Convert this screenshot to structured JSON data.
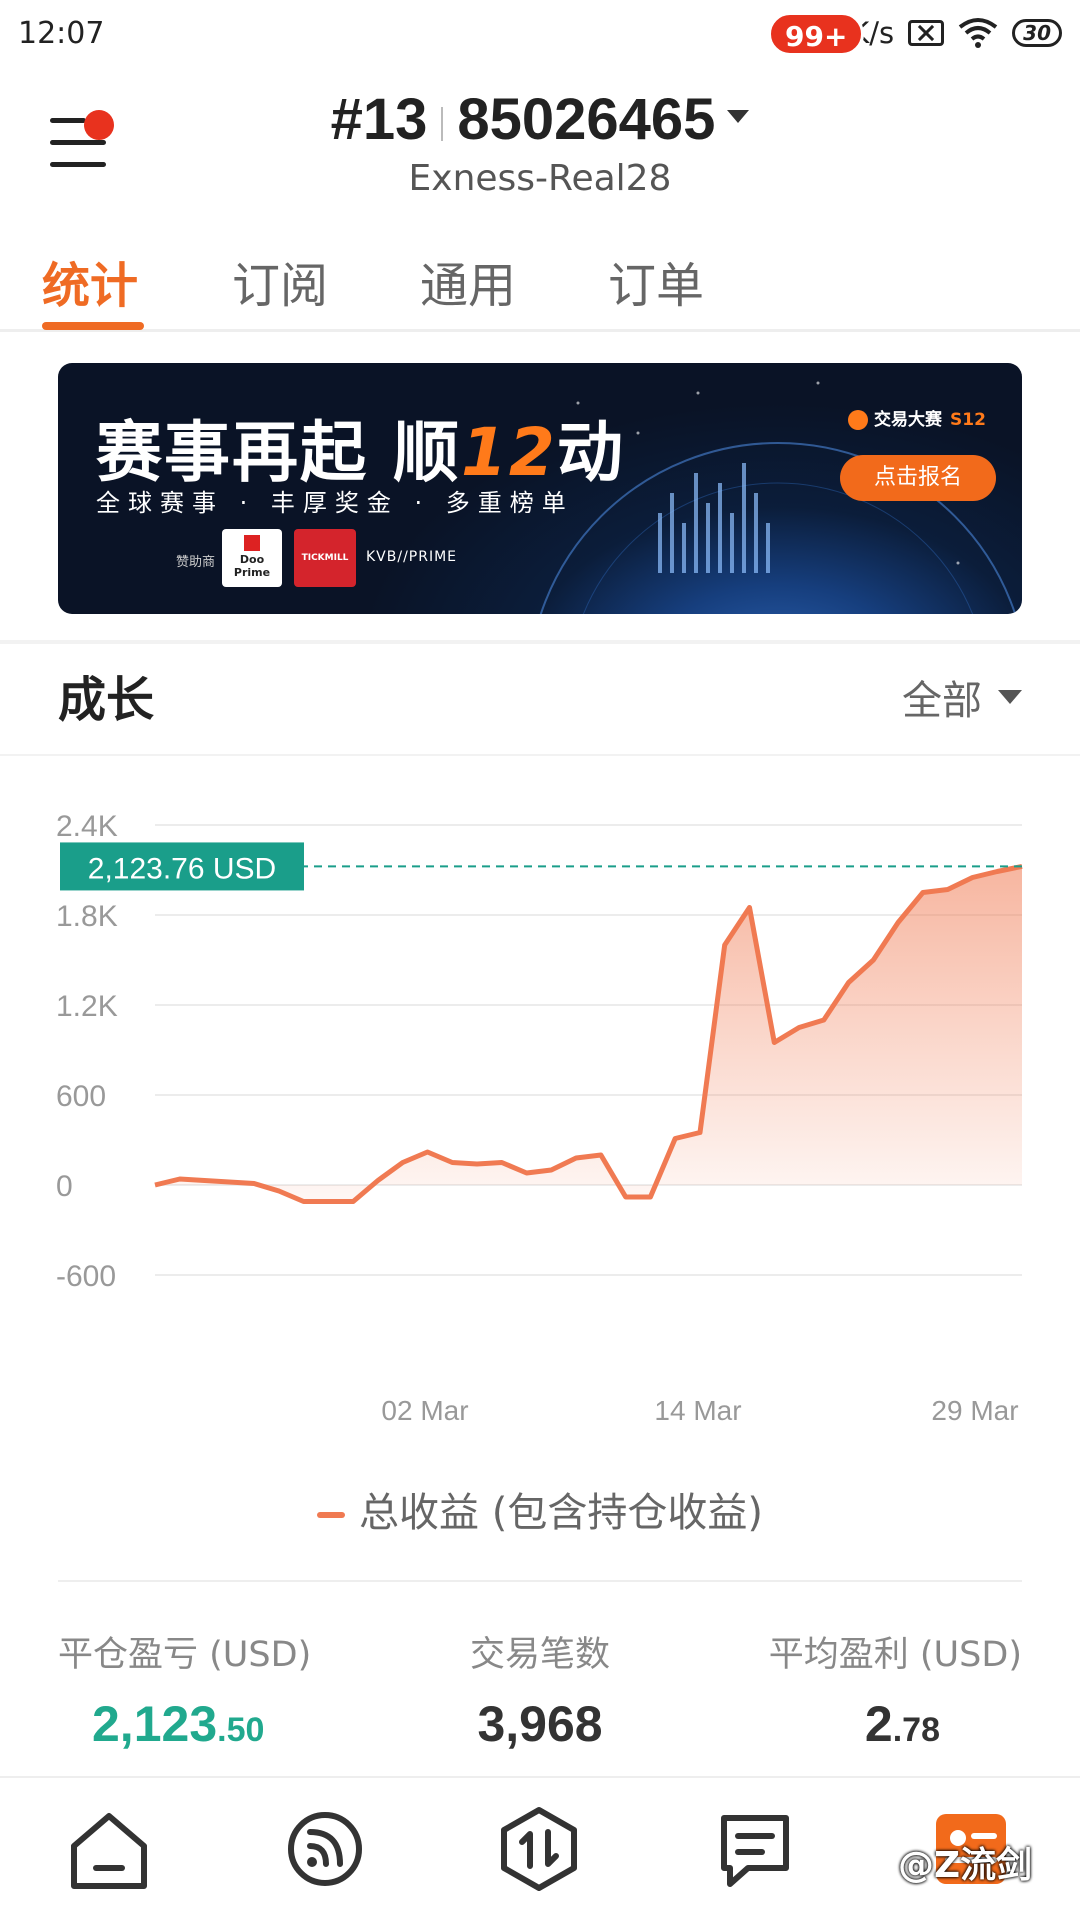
{
  "status_bar": {
    "time": "12:07",
    "net_speed": "1.5K/s",
    "battery": "30"
  },
  "header": {
    "account_prefix": "#13",
    "account_number": "85026465",
    "server": "Exness-Real28",
    "notification_dot": true
  },
  "tabs": [
    {
      "label": "统计",
      "active": true
    },
    {
      "label": "订阅",
      "active": false
    },
    {
      "label": "通用",
      "active": false
    },
    {
      "label": "订单",
      "active": false
    }
  ],
  "banner": {
    "title_a": "赛事再起 顺",
    "title_num": "12",
    "title_b": "动",
    "subtitle": "全球赛事 · 丰厚奖金 · 多重榜单",
    "sponsor_label": "赞助商",
    "sponsor_1": "Doo Prime",
    "sponsor_2": "TICKMILL",
    "sponsor_3": "KVB//PRIME",
    "brand": "交易大赛",
    "season": "S12",
    "cta": "点击报名"
  },
  "growth": {
    "title": "成长",
    "range": "全部"
  },
  "chart_data": {
    "type": "area",
    "current_value_label": "2,123.76 USD",
    "current_value": 2123.76,
    "y_ticks": [
      "2.4K",
      "1.8K",
      "1.2K",
      "600",
      "0",
      "-600"
    ],
    "ylim": [
      -600,
      2400
    ],
    "x_ticks": [
      "02 Mar",
      "14 Mar",
      "29 Mar"
    ],
    "series": [
      {
        "name": "总收益 (包含持仓收益)",
        "values": [
          0,
          40,
          30,
          20,
          10,
          -40,
          -110,
          -110,
          -110,
          30,
          150,
          220,
          150,
          140,
          150,
          80,
          100,
          180,
          200,
          -80,
          -80,
          310,
          350,
          1600,
          1850,
          950,
          1050,
          1100,
          1350,
          1500,
          1750,
          1950,
          1970,
          2050,
          2090,
          2123.76
        ]
      }
    ],
    "color": "#f07a52",
    "reference_line_color": "#1a9e8a"
  },
  "legend": {
    "label": "总收益 (包含持仓收益)"
  },
  "stats": [
    {
      "label": "平仓盈亏 (USD)",
      "value_int": "2,123",
      "value_dec": ".50"
    },
    {
      "label": "交易笔数",
      "value_int": "3,968",
      "value_dec": ""
    },
    {
      "label": "平均盈利 (USD)",
      "value_int": "2",
      "value_dec": ".78"
    }
  ],
  "nav": {
    "items": [
      "home-icon",
      "feed-icon",
      "trade-icon",
      "message-icon",
      "profile-icon"
    ],
    "message_badge": "99+"
  },
  "watermark": "@Z流剑"
}
